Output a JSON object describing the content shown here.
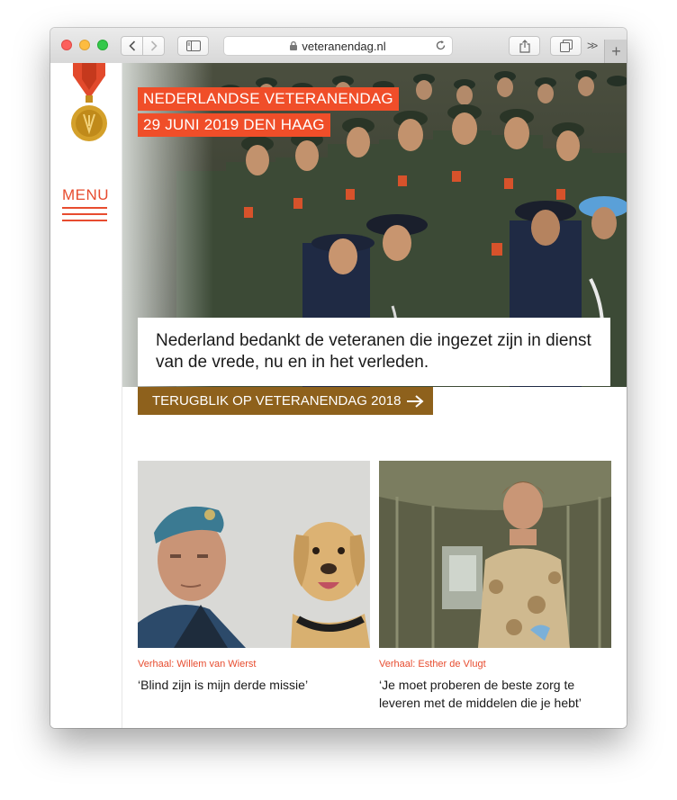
{
  "browser": {
    "url": "veteranendag.nl"
  },
  "site": {
    "menu_label": "MENU",
    "hero": {
      "tag_line1": "NEDERLANDSE VETERANENDAG",
      "tag_line2": "29 JUNI 2019 DEN HAAG",
      "quote": "Nederland bedankt de veteranen die ingezet zijn in dienst van de vrede, nu en in het verleden.",
      "cta_label": "TERUGBLIK OP VETERANENDAG 2018"
    },
    "cards": [
      {
        "kicker": "Verhaal: Willem van Wierst",
        "title": "‘Blind zijn is mijn derde missie’"
      },
      {
        "kicker": "Verhaal: Esther de Vlugt",
        "title": "‘Je moet proberen de beste zorg te leveren met de middelen die je hebt’"
      }
    ]
  },
  "colors": {
    "accent_red": "#f04e29",
    "accent_brown": "#8e611c"
  },
  "icons": {
    "toolbar": [
      "back-icon",
      "forward-icon",
      "sidebar-icon",
      "lock-icon",
      "reload-icon",
      "share-icon",
      "tabs-icon",
      "more-icon",
      "new-tab-icon"
    ],
    "site": [
      "medal-logo",
      "hamburger-icon",
      "arrow-right-icon"
    ]
  }
}
